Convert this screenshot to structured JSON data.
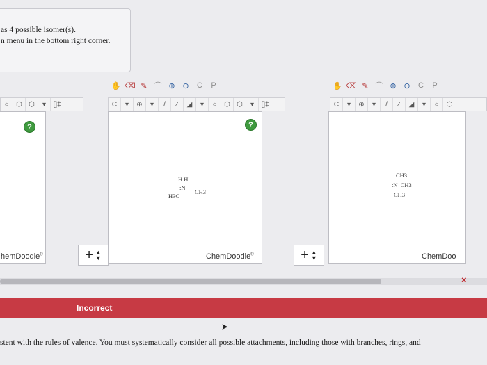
{
  "question": {
    "line1": "as 4 possible isomer(s).",
    "line2": "n menu in the bottom right corner."
  },
  "toolbar": {
    "icons": [
      "undo-hand-icon",
      "eraser-icon",
      "pencil-icon",
      "lasso-icon",
      "zoom-in-icon",
      "zoom-out-icon",
      "clean-icon",
      "periodic-table-icon"
    ],
    "carbon_label": "C",
    "dropdown_arrow": "▾",
    "charge_plus": "⊕",
    "bracket_label": "[]‡",
    "periodic_label_c": "C",
    "periodic_label_p": "P"
  },
  "panels": {
    "brand": "ChemDoodle",
    "brand_partial_left": "hemDoodle",
    "brand_partial_right": "ChemDoo",
    "help": "?",
    "add_control": "+"
  },
  "molecules": {
    "middle": {
      "line1": "H H",
      "line2": ":N",
      "left_group": "H3C",
      "right_group": "CH3"
    },
    "right": {
      "top": "CH3",
      "middle": ":N–CH3",
      "bottom": "CH3"
    }
  },
  "feedback": {
    "status": "Incorrect",
    "close": "×",
    "message": "stent with the rules of valence. You must systematically consider all possible attachments, including those with branches, rings, and"
  },
  "colors": {
    "incorrect_bar": "#c73a44",
    "help_green": "#3f9a3f",
    "close_red": "#c0262c"
  }
}
